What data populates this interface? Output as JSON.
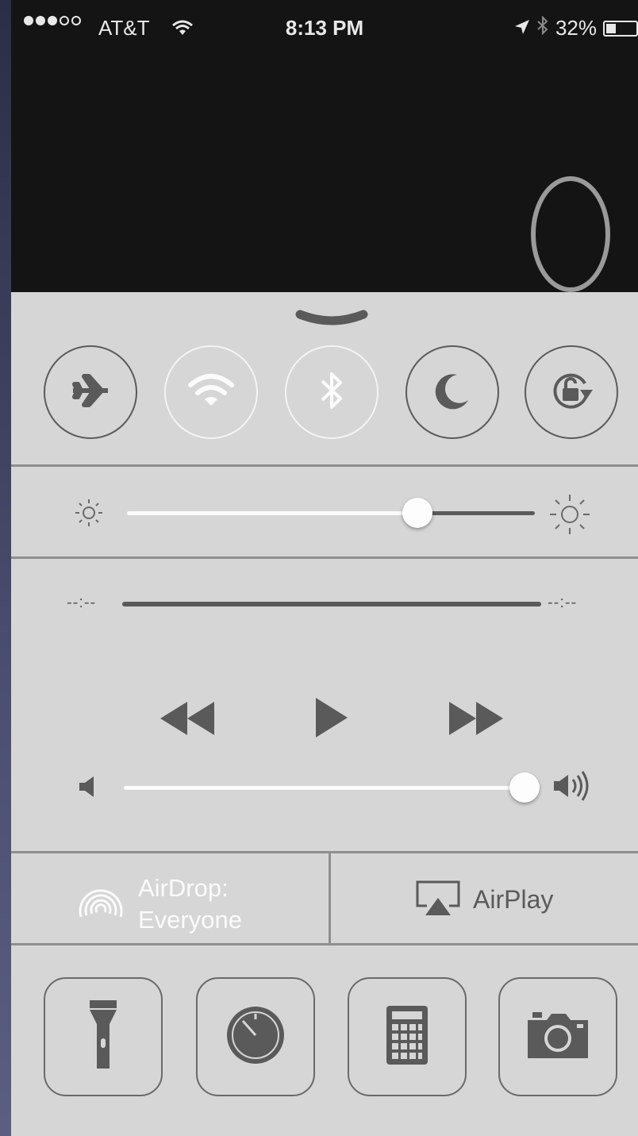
{
  "status_bar": {
    "carrier": "AT&T",
    "time": "8:13 PM",
    "battery_percent": "32%",
    "battery_level": 0.32,
    "signal_bars_filled": 3,
    "signal_bars_total": 5
  },
  "background_glyph": "0",
  "control_center": {
    "toggles": [
      {
        "name": "airplane-mode",
        "icon": "airplane-icon",
        "on": false
      },
      {
        "name": "wifi",
        "icon": "wifi-icon",
        "on": true
      },
      {
        "name": "bluetooth",
        "icon": "bluetooth-icon",
        "on": true
      },
      {
        "name": "do-not-disturb",
        "icon": "moon-icon",
        "on": false
      },
      {
        "name": "rotation-lock",
        "icon": "rotation-lock-icon",
        "on": false
      }
    ],
    "brightness_level": 0.73,
    "media": {
      "elapsed": "--:--",
      "remaining": "--:--",
      "volume_level": 1.0
    },
    "airdrop": {
      "line1": "AirDrop:",
      "line2": "Everyone"
    },
    "airplay": {
      "label": "AirPlay"
    },
    "shortcuts": [
      {
        "name": "flashlight",
        "icon": "flashlight-icon"
      },
      {
        "name": "timer",
        "icon": "timer-icon"
      },
      {
        "name": "calculator",
        "icon": "calculator-icon"
      },
      {
        "name": "camera",
        "icon": "camera-icon"
      }
    ]
  },
  "colors": {
    "panel": "#d6d6d6",
    "glyph_dark": "#5a5a5a",
    "glyph_on": "#fbfbfb",
    "screen_bg": "#141414"
  }
}
